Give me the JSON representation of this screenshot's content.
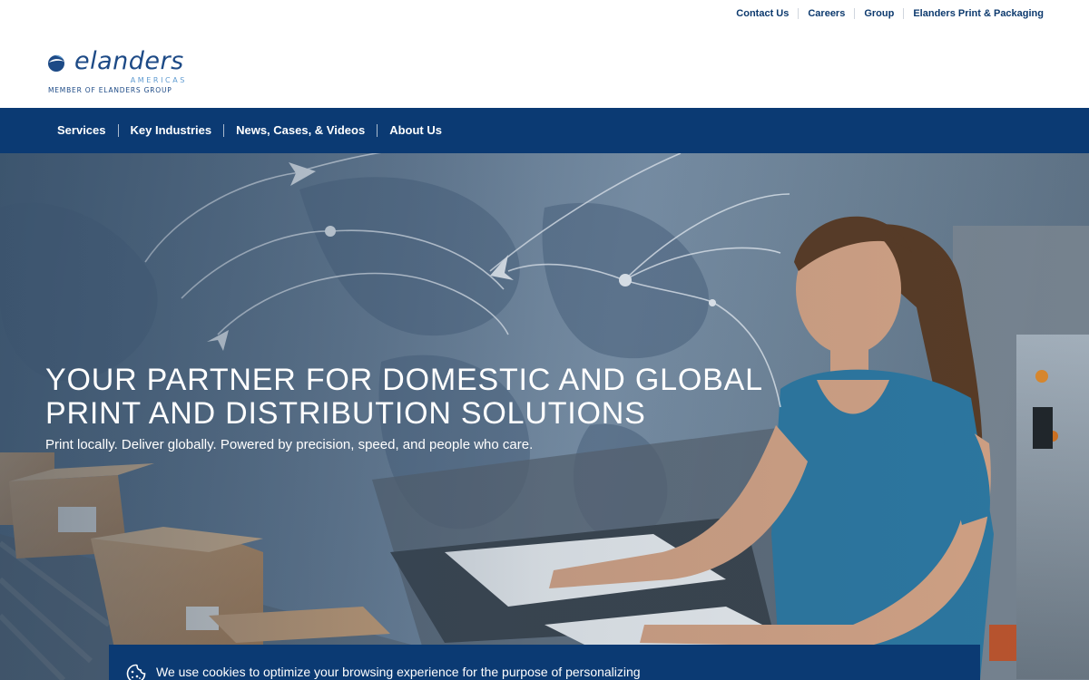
{
  "utility_nav": [
    "Contact Us",
    "Careers",
    "Group",
    "Elanders Print & Packaging"
  ],
  "logo": {
    "wordmark": "elanders",
    "region": "AMERICAS",
    "tagline": "MEMBER OF ELANDERS GROUP"
  },
  "main_nav": [
    "Services",
    "Key Industries",
    "News, Cases, & Videos",
    "About Us"
  ],
  "hero": {
    "headline": "YOUR PARTNER FOR DOMESTIC AND GLOBAL PRINT AND DISTRIBUTION SOLUTIONS",
    "tagline": "Print locally. Deliver globally. Powered by precision, speed, and people who care."
  },
  "cookie_banner": {
    "text": "We use cookies to optimize your browsing experience for the purpose of personalizing",
    "icon": "cookie-icon"
  },
  "colors": {
    "brand_navy": "#0b3a73",
    "brand_light_blue": "#5f9bd1",
    "nav_text": "#ffffff"
  }
}
